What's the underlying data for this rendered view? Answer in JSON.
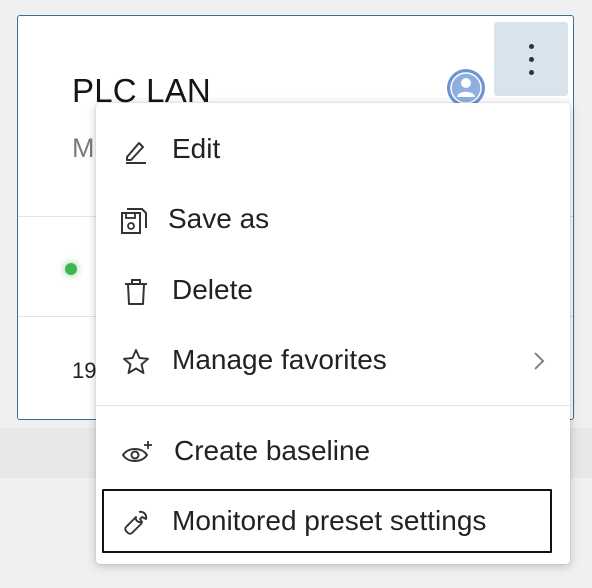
{
  "card": {
    "title": "PLC LAN",
    "subtitle": "M",
    "row_value": "19"
  },
  "kebab": {
    "icon": "kebab-vertical-icon"
  },
  "badge": {
    "icon": "user-badge-icon",
    "color": "#5a88c8"
  },
  "menu": {
    "items": [
      {
        "label": "Edit",
        "icon": "pencil-icon"
      },
      {
        "label": "Save as",
        "icon": "save-as-icon"
      },
      {
        "label": "Delete",
        "icon": "trash-icon"
      },
      {
        "label": "Manage favorites",
        "icon": "star-icon",
        "submenu": true
      },
      {
        "label": "Create baseline",
        "icon": "eye-plus-icon"
      },
      {
        "label": "Monitored preset settings",
        "icon": "wrench-icon",
        "highlighted": true
      }
    ]
  },
  "colors": {
    "card_border": "#3e6d8e",
    "status_online": "#3fb652",
    "kebab_bg": "#d9e3ec"
  }
}
